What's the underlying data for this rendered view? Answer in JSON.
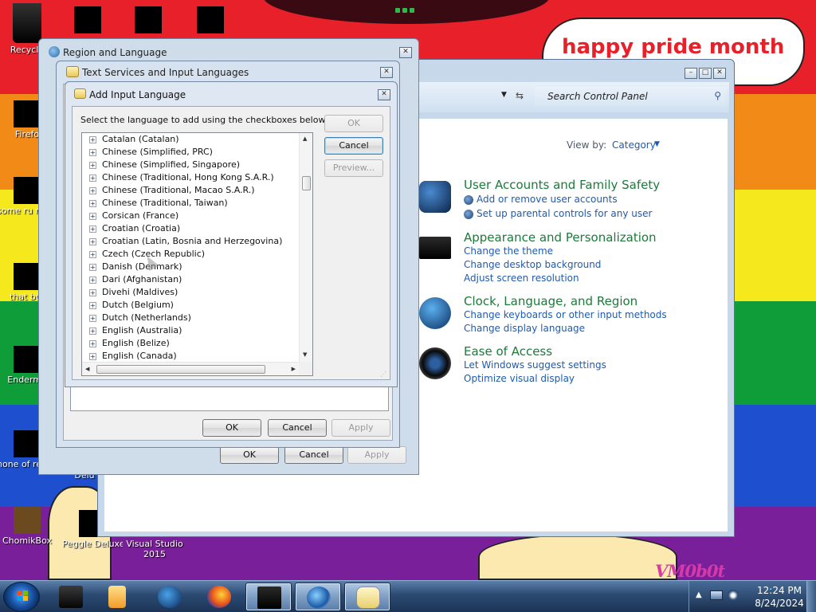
{
  "desktop": {
    "speech_bubble_text": "happy pride month",
    "watermark": "VM0b0t",
    "icons": [
      {
        "label": "Recycle"
      },
      {
        "label": "Firefo"
      },
      {
        "label": "some ru ran a"
      },
      {
        "label": "that but"
      },
      {
        "label": "Enderma"
      },
      {
        "label": "none of retards kno..."
      },
      {
        "label": "Delu"
      },
      {
        "label": "ChomikBox"
      },
      {
        "label": "Peggle Deluxe"
      },
      {
        "label": "Visual Studio 2015"
      }
    ]
  },
  "control_panel": {
    "search_placeholder": "Search Control Panel",
    "view_by_label": "View by:",
    "view_by_value": "Category",
    "categories": [
      {
        "title": "User Accounts and Family Safety",
        "links": [
          "Add or remove user accounts",
          "Set up parental controls for any user"
        ]
      },
      {
        "title": "Appearance and Personalization",
        "links": [
          "Change the theme",
          "Change desktop background",
          "Adjust screen resolution"
        ]
      },
      {
        "title": "Clock, Language, and Region",
        "links": [
          "Change keyboards or other input methods",
          "Change display language"
        ]
      },
      {
        "title": "Ease of Access",
        "links": [
          "Let Windows suggest settings",
          "Optimize visual display"
        ]
      }
    ]
  },
  "region_dialog": {
    "title": "Region and Language",
    "ok": "OK",
    "cancel": "Cancel",
    "apply": "Apply"
  },
  "text_services_dialog": {
    "title": "Text Services and Input Languages",
    "ok": "OK",
    "cancel": "Cancel",
    "apply": "Apply"
  },
  "add_input_language": {
    "title": "Add Input Language",
    "instructions": "Select the language to add using the checkboxes below.",
    "ok": "OK",
    "cancel": "Cancel",
    "preview": "Preview...",
    "languages": [
      "Catalan (Catalan)",
      "Chinese (Simplified, PRC)",
      "Chinese (Simplified, Singapore)",
      "Chinese (Traditional, Hong Kong S.A.R.)",
      "Chinese (Traditional, Macao S.A.R.)",
      "Chinese (Traditional, Taiwan)",
      "Corsican (France)",
      "Croatian (Croatia)",
      "Croatian (Latin, Bosnia and Herzegovina)",
      "Czech (Czech Republic)",
      "Danish (Denmark)",
      "Dari (Afghanistan)",
      "Divehi (Maldives)",
      "Dutch (Belgium)",
      "Dutch (Netherlands)",
      "English (Australia)",
      "English (Belize)",
      "English (Canada)"
    ]
  },
  "taskbar": {
    "time": "12:24 PM",
    "date": "8/24/2024"
  }
}
